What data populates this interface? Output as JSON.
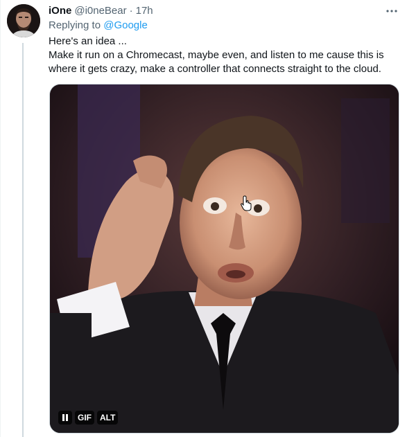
{
  "tweet": {
    "display_name": "iOne",
    "handle": "@i0neBear",
    "separator": "·",
    "time": "17h",
    "replying_prefix": "Replying to",
    "replying_to": "@Google",
    "text_lines": [
      "Here's an idea ...",
      "Make it run on a Chromecast, maybe even, and listen to me cause this is where it gets crazy, make a controller that connects straight to the cloud."
    ]
  },
  "media": {
    "type": "gif",
    "gif_badge": "GIF",
    "alt_badge": "ALT"
  },
  "icons": {
    "more": "more-horizontal-icon",
    "pause": "pause-icon",
    "cursor": "hand-pointer-icon"
  },
  "colors": {
    "link": "#1d9bf0",
    "secondary_text": "#536471",
    "primary_text": "#0f1419"
  }
}
